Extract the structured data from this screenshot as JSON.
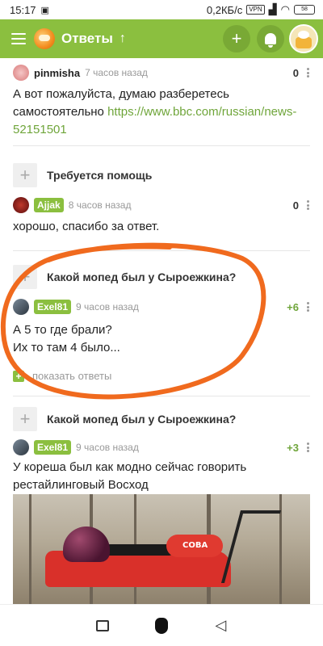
{
  "statusbar": {
    "time": "15:17",
    "speed": "0,2КБ/с",
    "vpn": "VPN",
    "battery": "58"
  },
  "appbar": {
    "title": "Ответы",
    "accent": "#8bbf3f"
  },
  "feed": {
    "answer1": {
      "user": "pinmisha",
      "time": "7 часов назад",
      "score": "0",
      "text": "А вот пожалуйста,  думаю разберетесь самостоятельно ",
      "link": "https://www.bbc.com/russian/news-52151501"
    },
    "question1": {
      "title": "Требуется помощь"
    },
    "answer2": {
      "user": "Ajjak",
      "time": "8 часов назад",
      "score": "0",
      "text": "хорошо, спасибо за ответ."
    },
    "question2": {
      "title": "Какой мопед был у Сыроежкина?"
    },
    "answer3": {
      "user": "Exel81",
      "time": "9 часов назад",
      "score": "+6",
      "line1": "А 5 то где брали?",
      "line2": "Их то там 4 было..."
    },
    "show_answers": "показать ответы",
    "question3": {
      "title": "Какой мопед был у Сыроежкина?"
    },
    "answer4": {
      "user": "Exel81",
      "time": "9 часов назад",
      "score": "+3",
      "text": "У кореша был как модно сейчас говорить рестайлинговый Восход"
    },
    "photo_label": "СОВА"
  },
  "annotation_color": "#f06a1e"
}
